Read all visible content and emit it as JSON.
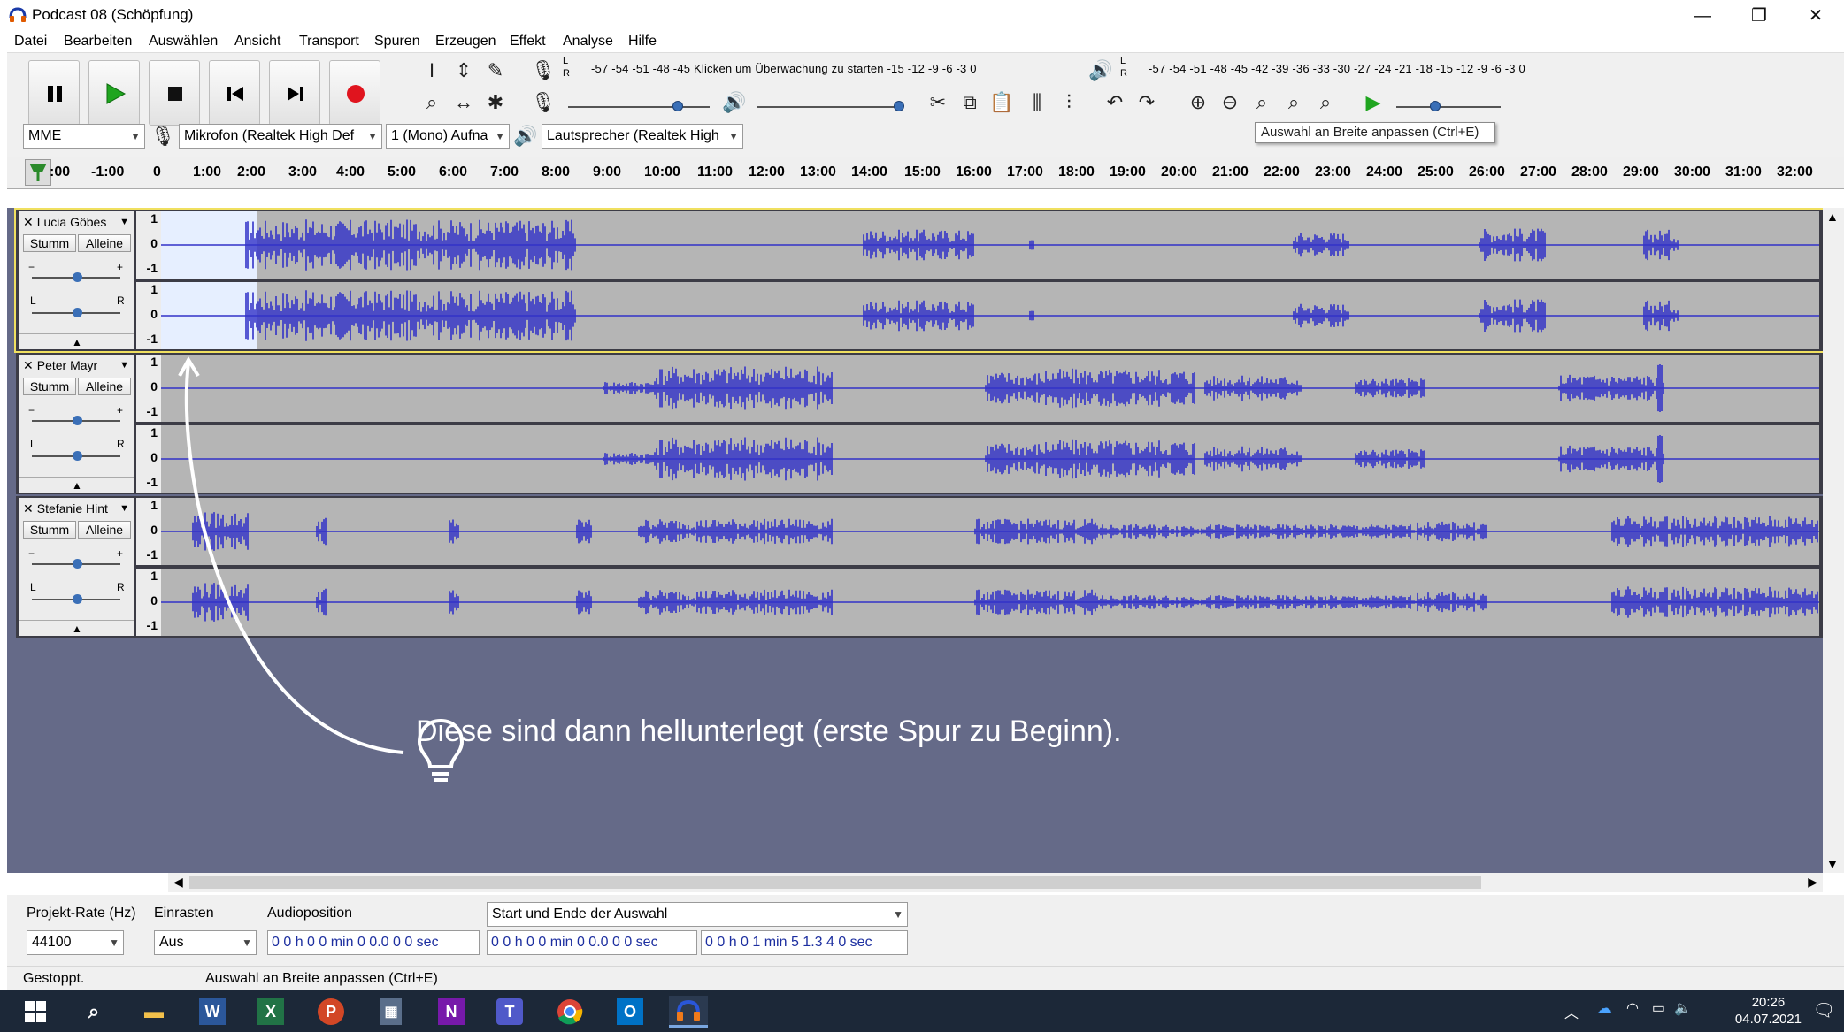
{
  "window": {
    "title": "Podcast 08 (Schöpfung)",
    "controls": {
      "minimize": "—",
      "restore": "❐",
      "close": "✕"
    }
  },
  "menu": [
    "Datei",
    "Bearbeiten",
    "Auswählen",
    "Ansicht",
    "Transport",
    "Spuren",
    "Erzeugen",
    "Effekt",
    "Analyse",
    "Hilfe"
  ],
  "transport": {
    "pause": "pause-icon",
    "play": "play-icon",
    "stop": "stop-icon",
    "skip_start": "skip-start-icon",
    "skip_end": "skip-end-icon",
    "record": "record-icon"
  },
  "meters": {
    "recording_scale": "-57 -54 -51 -48 -45 Klicken um Überwachung zu starten -15 -12 -9 -6 -3 0",
    "playback_scale": "-57 -54 -51 -48 -45 -42 -39 -36 -33 -30 -27 -24 -21 -18 -15 -12 -9 -6 -3 0",
    "L": "L",
    "R": "R"
  },
  "device": {
    "host": "MME",
    "input": "Mikrofon (Realtek High Def",
    "channels": "1 (Mono) Aufna",
    "output": "Lautsprecher (Realtek High"
  },
  "tooltip": "Auswahl an Breite anpassen (Ctrl+E)",
  "ruler": {
    "ticks": [
      ":00",
      "-1:00",
      "0",
      "1:00",
      "2:00",
      "3:00",
      "4:00",
      "5:00",
      "6:00",
      "7:00",
      "8:00",
      "9:00",
      "10:00",
      "11:00",
      "12:00",
      "13:00",
      "14:00",
      "15:00",
      "16:00",
      "17:00",
      "18:00",
      "19:00",
      "20:00",
      "21:00",
      "22:00",
      "23:00",
      "24:00",
      "25:00",
      "26:00",
      "27:00",
      "28:00",
      "29:00",
      "30:00",
      "31:00",
      "32:00"
    ]
  },
  "tracks": [
    {
      "name": "Lucia Göbes",
      "mute": "Stumm",
      "solo": "Alleine",
      "selected": true
    },
    {
      "name": "Peter Mayr",
      "mute": "Stumm",
      "solo": "Alleine",
      "selected": false
    },
    {
      "name": "Stefanie Hint",
      "mute": "Stumm",
      "solo": "Alleine",
      "selected": false
    }
  ],
  "scale_labels": {
    "top": "1",
    "mid": "0",
    "bot": "-1"
  },
  "gain": {
    "minus": "−",
    "plus": "+"
  },
  "pan": {
    "left": "L",
    "right": "R"
  },
  "hint": "Diese sind dann hellunterlegt (erste Spur zu Beginn).",
  "bottom": {
    "rate_label": "Projekt-Rate (Hz)",
    "rate_value": "44100",
    "snap_label": "Einrasten",
    "snap_value": "Aus",
    "audiopos_label": "Audioposition",
    "audiopos_value": "0 0 h 0 0 min 0 0.0 0 0 sec",
    "selection_label": "Start und Ende der Auswahl",
    "sel_start": "0 0 h 0 0 min 0 0.0 0 0 sec",
    "sel_end": "0 0 h 0 1 min 5 1.3 4 0 sec"
  },
  "status": {
    "left": "Gestoppt.",
    "right": "Auswahl an Breite anpassen (Ctrl+E)"
  },
  "taskbar": {
    "time": "20:26",
    "date": "04.07.2021",
    "apps": [
      "windows-start-icon",
      "search-icon",
      "file-explorer-icon",
      "word-icon",
      "excel-icon",
      "powerpoint-icon",
      "calculator-icon",
      "onenote-icon",
      "teams-icon",
      "chrome-icon",
      "outlook-icon",
      "audacity-icon"
    ]
  },
  "colors": {
    "waveform": "#3232c8",
    "track_bg": "#b5b5b5",
    "selection": "#e6efff",
    "area": "#656a88"
  }
}
